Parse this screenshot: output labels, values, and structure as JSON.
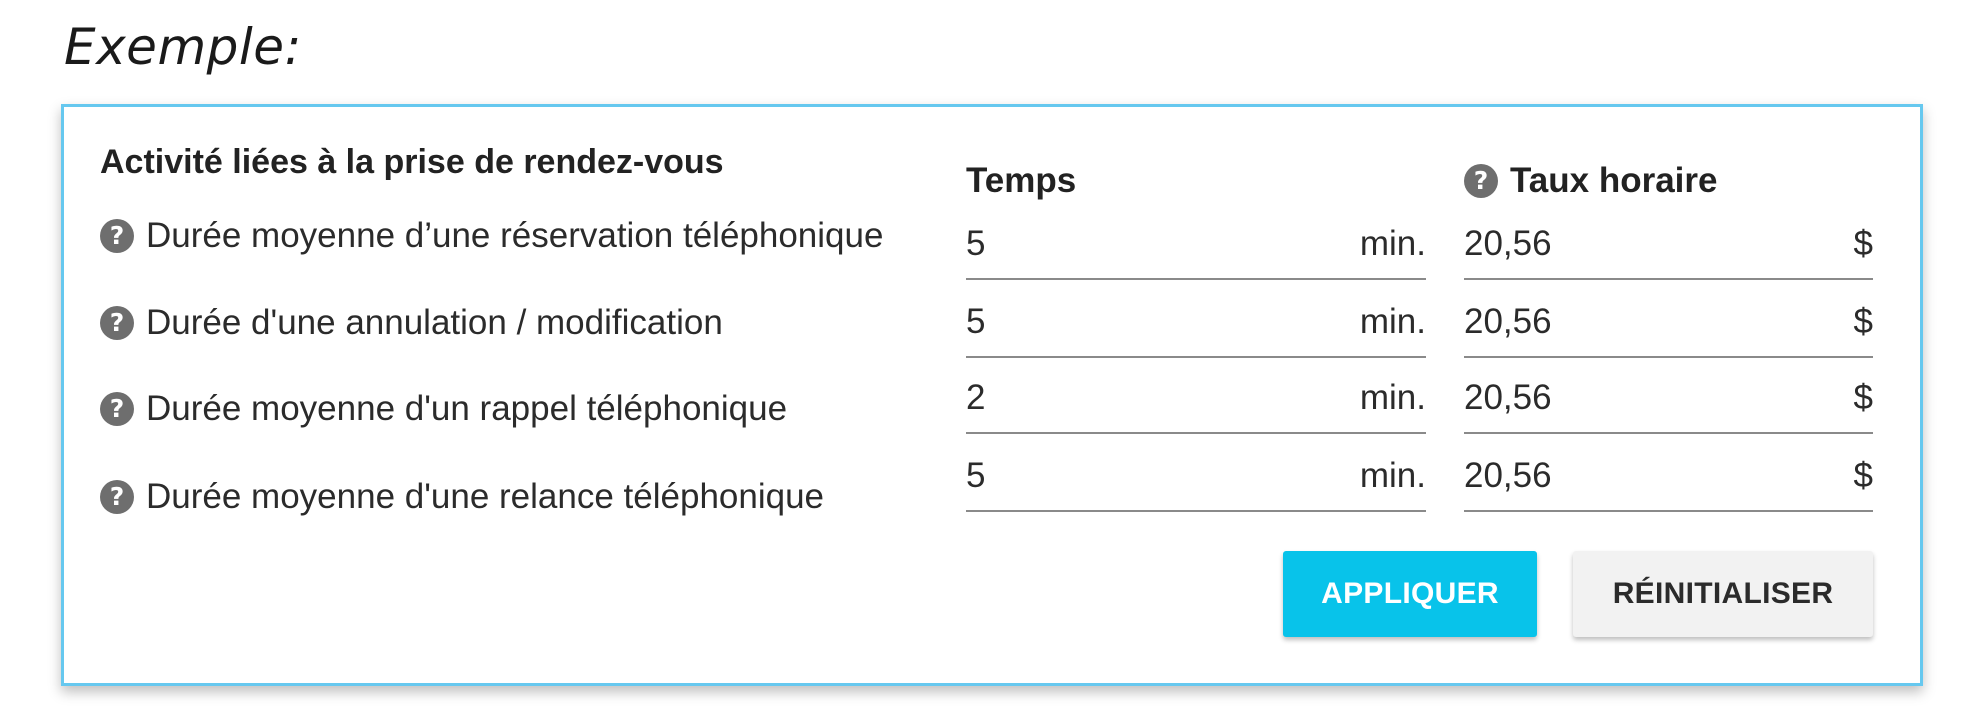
{
  "example_label": "Exemple:",
  "panel": {
    "title": "Activité liées à la prise de rendez-vous",
    "columns": {
      "temps": "Temps",
      "taux": "Taux horaire"
    },
    "rows": [
      {
        "label": "Durée moyenne d’une réservation téléphonique",
        "temps": "5",
        "temps_unit": "min.",
        "taux": "20,56",
        "taux_unit": "$"
      },
      {
        "label": "Durée d'une annulation / modification",
        "temps": "5",
        "temps_unit": "min.",
        "taux": "20,56",
        "taux_unit": "$"
      },
      {
        "label": "Durée moyenne d'un rappel téléphonique",
        "temps": "2",
        "temps_unit": "min.",
        "taux": "20,56",
        "taux_unit": "$"
      },
      {
        "label": "Durée moyenne d'une relance téléphonique",
        "temps": "5",
        "temps_unit": "min.",
        "taux": "20,56",
        "taux_unit": "$"
      }
    ],
    "buttons": {
      "apply": "APPLIQUER",
      "reset": "RÉINITIALISER"
    }
  },
  "icons": {
    "help": "help-circle-icon"
  },
  "colors": {
    "accent": "#08c3ea",
    "border": "#66c8ef",
    "icon_gray": "#6e6e6e"
  }
}
